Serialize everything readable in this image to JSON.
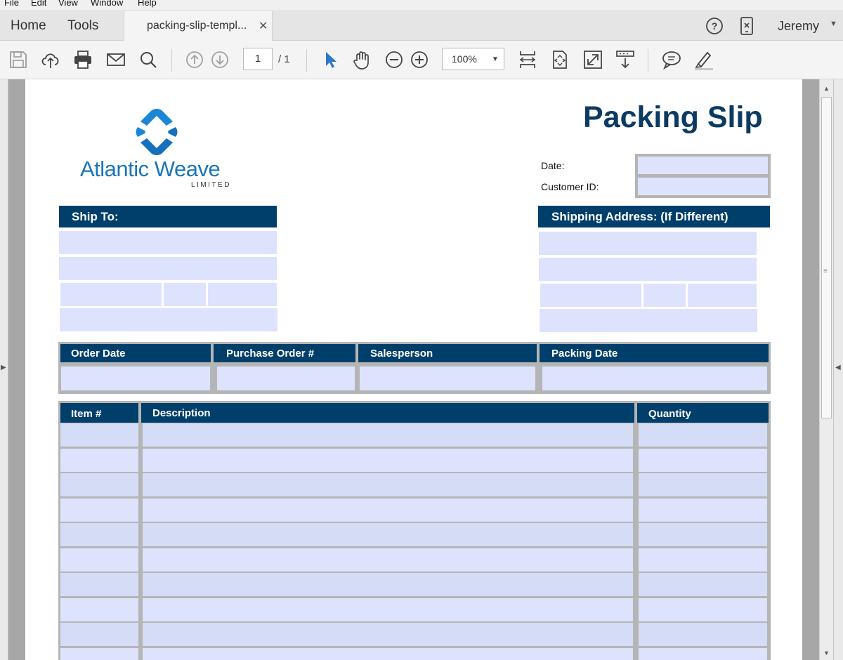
{
  "menu": [
    "File",
    "Edit",
    "View",
    "Window",
    "Help"
  ],
  "nav": {
    "home": "Home",
    "tools": "Tools"
  },
  "tab": {
    "title": "packing-slip-templ...",
    "close": "✕"
  },
  "user": {
    "name": "Jeremy"
  },
  "toolbar": {
    "page_current": "1",
    "page_total": "/ 1",
    "zoom": "100%"
  },
  "document": {
    "title": "Packing Slip",
    "brand_name": "Atlantic Weave",
    "brand_sub": "LIMITED",
    "date_label": "Date:",
    "customer_id_label": "Customer ID:",
    "ship_to": "Ship To:",
    "shipping_address": "Shipping Address: (If Different)",
    "order_headers": [
      "Order Date",
      "Purchase Order #",
      "Salesperson",
      "Packing Date"
    ],
    "item_headers": [
      "Item #",
      "Description",
      "Quantity"
    ]
  },
  "colors": {
    "accent": "#003f6b",
    "field": "#dde3fd",
    "brand": "#1a75bb"
  }
}
